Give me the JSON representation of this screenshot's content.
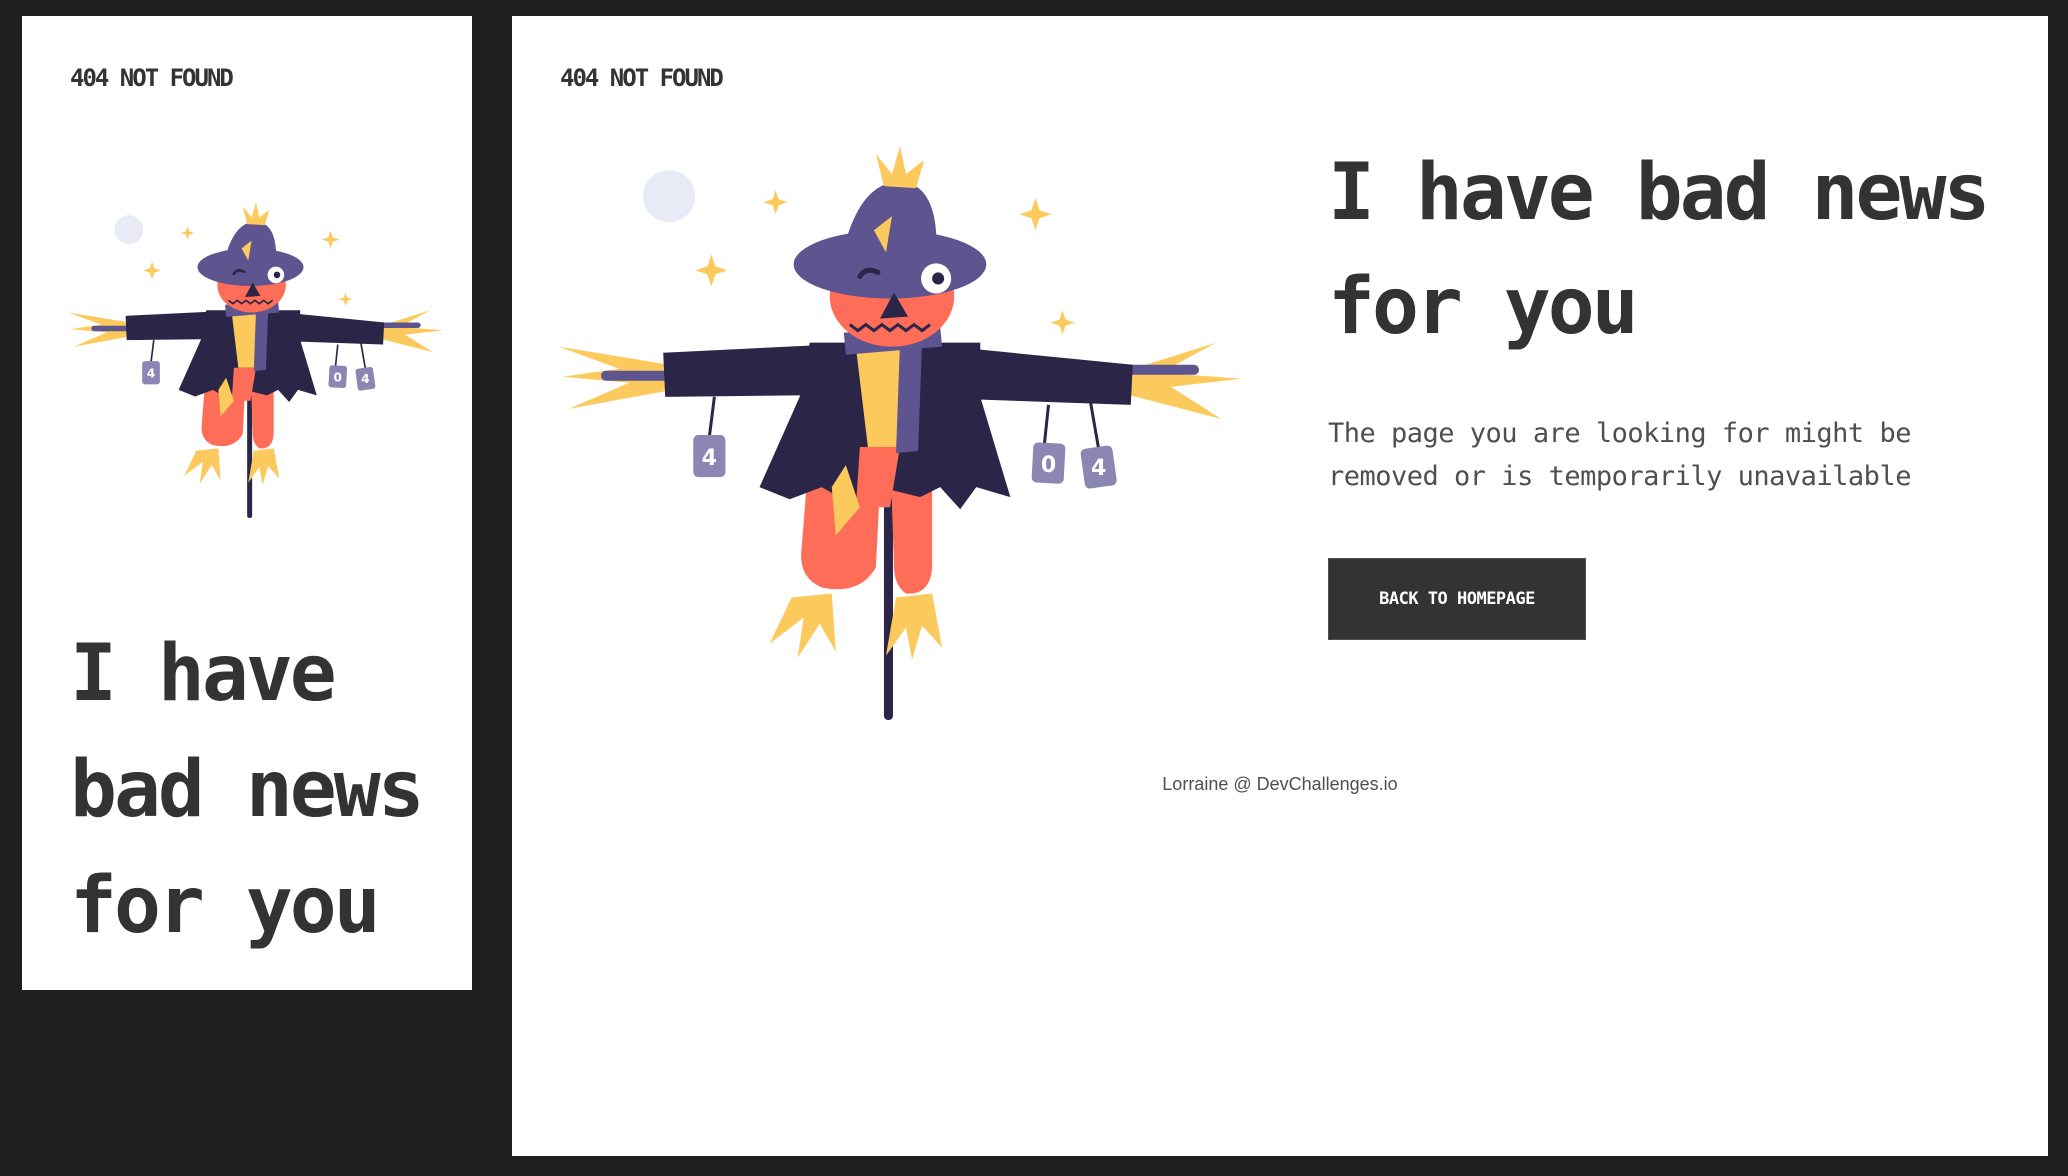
{
  "mobile": {
    "logo": "404 NOT FOUND",
    "headline": "I have bad news for you"
  },
  "desktop": {
    "logo": "404 NOT FOUND",
    "headline": "I have bad news for you",
    "subtext": "The page you are looking for might be removed or is temporarily unavailable",
    "cta_label": "BACK TO HOMEPAGE",
    "footer": "Lorraine @ DevChallenges.io"
  },
  "illustration": {
    "can_labels": [
      "4",
      "0",
      "4"
    ]
  },
  "colors": {
    "background": "#1f1f1f",
    "text": "#333333",
    "button": "#333333",
    "jacket": "#2b2548",
    "hat": "#5e5490",
    "skin": "#fd6d58",
    "straw": "#fcca5c",
    "can": "#8b86b4",
    "moon": "#e8eaf6"
  }
}
